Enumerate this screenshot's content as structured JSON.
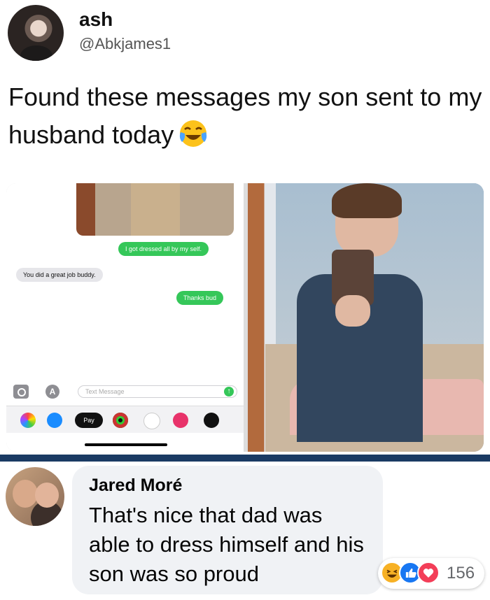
{
  "tweet": {
    "author_name": "ash",
    "author_handle": "@Abkjames1",
    "text": "Found these messages my son sent to my husband today",
    "emoji": "face-with-tears-of-joy-icon"
  },
  "imessage": {
    "messages": [
      {
        "text": "I got dressed all by my self.",
        "side": "sent"
      },
      {
        "text": "You did a great job buddy.",
        "side": "received"
      },
      {
        "text": "Thanks bud",
        "side": "sent"
      }
    ],
    "input_placeholder": "Text Message",
    "apple_pay_label": "Pay"
  },
  "comment": {
    "author": "Jared Moré",
    "text": "That's nice that dad was able to dress himself and his son was so proud",
    "reactions": [
      "haha",
      "like",
      "love"
    ],
    "reaction_count": "156"
  },
  "colors": {
    "divider": "#1a3a63",
    "imessage_green": "#35c759",
    "fb_like": "#1877f2",
    "fb_love": "#f33e58",
    "fb_haha": "#f7b125"
  }
}
